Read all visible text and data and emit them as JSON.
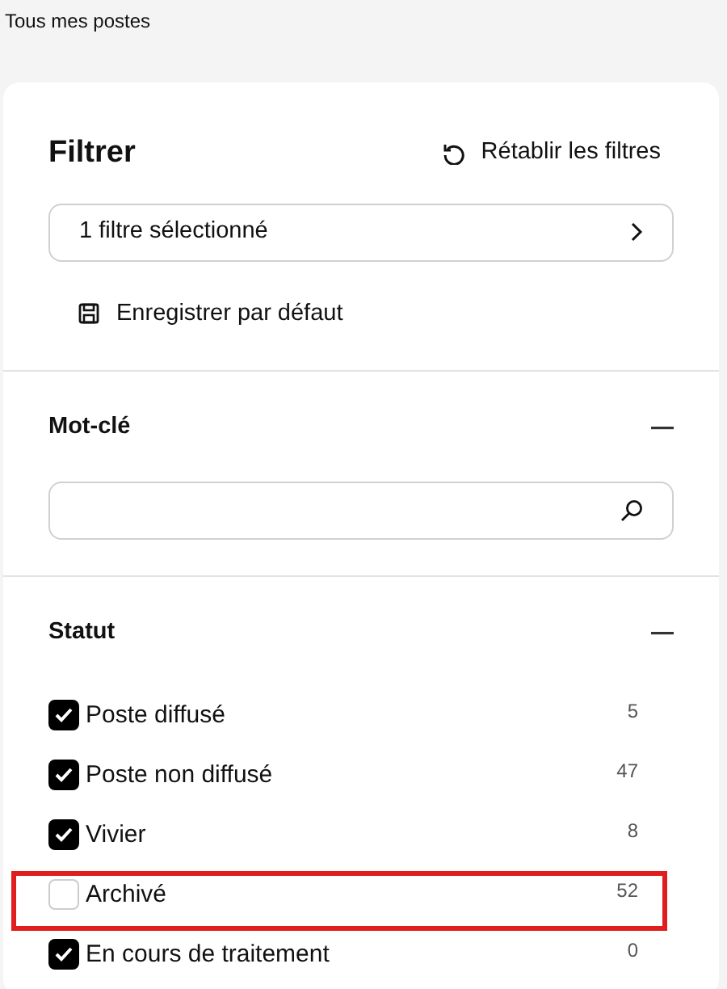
{
  "page_title": "Tous mes postes",
  "filter_panel": {
    "title": "Filtrer",
    "reset_label": "Rétablir les filtres",
    "selection_label": "1 filtre sélectionné",
    "save_label": "Enregistrer par défaut",
    "sections": [
      {
        "kind": "keyword",
        "title": "Mot-clé",
        "expanded": true
      },
      {
        "kind": "checklist",
        "title": "Statut",
        "expanded": true,
        "items": [
          {
            "label": "Poste diffusé",
            "count": "5",
            "checked": true,
            "highlighted": false
          },
          {
            "label": "Poste non diffusé",
            "count": "47",
            "checked": true,
            "highlighted": false
          },
          {
            "label": "Vivier",
            "count": "8",
            "checked": true,
            "highlighted": false
          },
          {
            "label": "Archivé",
            "count": "52",
            "checked": false,
            "highlighted": true
          },
          {
            "label": "En cours de traitement",
            "count": "0",
            "checked": true,
            "highlighted": false
          }
        ]
      }
    ]
  }
}
